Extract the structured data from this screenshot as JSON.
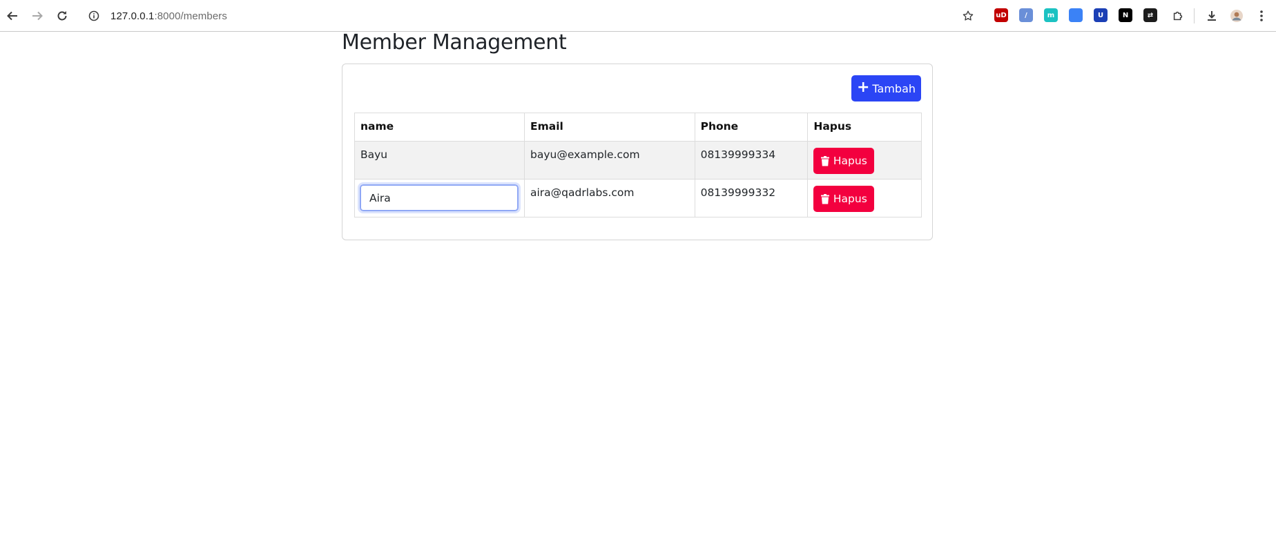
{
  "browser": {
    "url_host": "127.0.0.1",
    "url_path": ":8000/members",
    "extensions": [
      {
        "name": "ublock-icon",
        "label": "uD",
        "color": "#c20000"
      },
      {
        "name": "extension-blue-icon",
        "label": "/",
        "color": "#6a8fd8"
      },
      {
        "name": "extension-m-icon",
        "label": "m",
        "color": "#1cc2c2"
      },
      {
        "name": "extension-doc-icon",
        "label": "",
        "color": "#3b82f6"
      },
      {
        "name": "bitwarden-icon",
        "label": "U",
        "color": "#1b3fb5"
      },
      {
        "name": "notion-icon",
        "label": "N",
        "color": "#000000"
      },
      {
        "name": "extension-dark-icon",
        "label": "⇄",
        "color": "#1c1c1c"
      }
    ]
  },
  "page": {
    "title": "Member Management",
    "add_button_label": "Tambah"
  },
  "table": {
    "headers": [
      "name",
      "Email",
      "Phone",
      "Hapus"
    ],
    "rows": [
      {
        "name": "Bayu",
        "email": "bayu@example.com",
        "phone": "08139999334",
        "delete_label": "Hapus"
      },
      {
        "name": "Aira",
        "email": "aira@qadrlabs.com",
        "phone": "08139999332",
        "delete_label": "Hapus"
      }
    ]
  },
  "colors": {
    "primary": "#2b45f5",
    "danger": "#f3003f"
  }
}
